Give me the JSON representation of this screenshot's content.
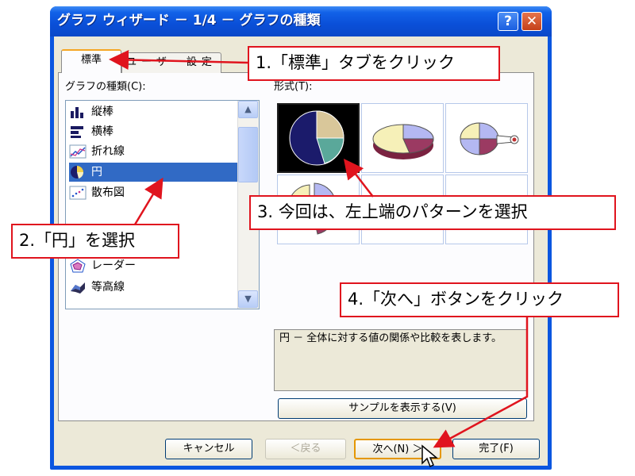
{
  "window": {
    "title": "グラフ ウィザード － 1/4 － グラフの種類",
    "help_label": "?",
    "close_label": "✕"
  },
  "tabs": [
    {
      "label": "標準",
      "selected": true
    },
    {
      "label": "ユーザー設定",
      "selected": false
    }
  ],
  "chart_type": {
    "label": "グラフの種類(C):",
    "items": [
      {
        "label": "縦棒",
        "icon": "column-chart-icon"
      },
      {
        "label": "横棒",
        "icon": "bar-chart-icon"
      },
      {
        "label": "折れ線",
        "icon": "line-chart-icon"
      },
      {
        "label": "円",
        "icon": "pie-chart-icon",
        "selected": true
      },
      {
        "label": "散布図",
        "icon": "scatter-chart-icon"
      },
      {
        "label": "レーダー",
        "icon": "radar-chart-icon"
      },
      {
        "label": "等高線",
        "icon": "surface-chart-icon"
      }
    ]
  },
  "format": {
    "label": "形式(T):",
    "selected_index": 0
  },
  "description": "円 － 全体に対する値の関係や比較を表します。",
  "buttons": {
    "sample": "サンプルを表示する(V)",
    "cancel": "キャンセル",
    "back": "＜戻る",
    "next": "次へ(N) ＞",
    "finish": "完了(F)"
  },
  "annotations": {
    "step1": "1.「標準」タブをクリック",
    "step2": "2.「円」を選択",
    "step3": "3. 今回は、左上端のパターンを選択",
    "step4": "4.「次へ」ボタンをクリック"
  },
  "colors": {
    "titlebar": "#0a4fd8",
    "selection": "#316ac5",
    "annotation_red": "#e0141e"
  }
}
